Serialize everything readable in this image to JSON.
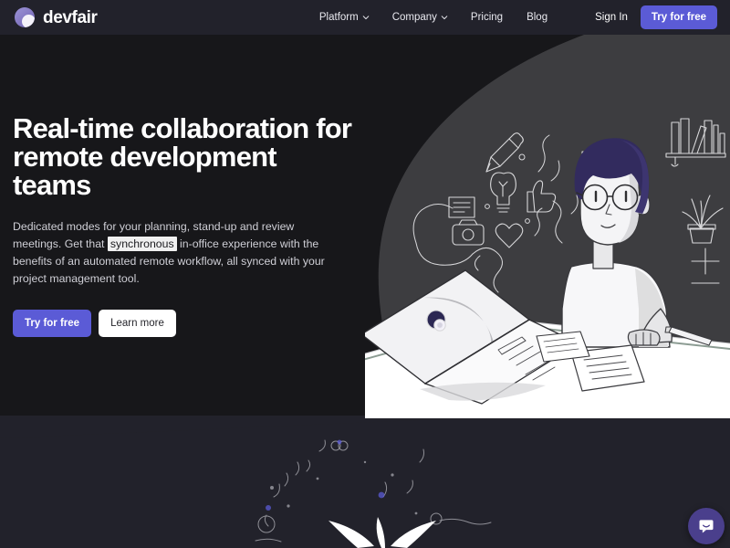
{
  "brand": {
    "name": "devfair",
    "logo_icon": "devfair-crescent-logo",
    "accent_color": "#5b5bd6",
    "logo_gradient_from": "#9b93d6",
    "logo_gradient_to": "#6f62b0"
  },
  "navbar": {
    "links": [
      {
        "label": "Platform",
        "has_dropdown": true,
        "icon": "chevron-down-icon"
      },
      {
        "label": "Company",
        "has_dropdown": true,
        "icon": "chevron-down-icon"
      },
      {
        "label": "Pricing",
        "has_dropdown": false,
        "icon": ""
      },
      {
        "label": "Blog",
        "has_dropdown": false,
        "icon": ""
      }
    ],
    "sign_in_label": "Sign In",
    "cta_label": "Try for free",
    "background_color": "#22222b"
  },
  "hero": {
    "headline": "Real-time collaboration for remote development teams",
    "subcopy_part1": "Dedicated modes for your planning, stand-up and review meetings. Get that ",
    "subcopy_highlight": "synchronous",
    "subcopy_part2": " in-office experience with the benefits of an automated remote workflow, all synced with your project management tool.",
    "primary_cta": "Try for free",
    "secondary_cta": "Learn more",
    "background_color": "#17171a",
    "blob_color": "#3d3d40",
    "lower_section_color": "#22222b"
  },
  "illustration": {
    "name": "developer-at-desk-illustration",
    "elements": [
      "pencil-doodle-icon",
      "lightbulb-doodle-icon",
      "thumbs-up-doodle-icon",
      "heart-doodle-icon",
      "document-doodle-icon",
      "camera-doodle-icon",
      "picture-frame-icon",
      "bookshelf-icon",
      "plant-icon",
      "laptop-icon",
      "person-with-glasses",
      "papers-on-desk",
      "pen-on-desk"
    ],
    "hair_color": "#322b5e",
    "skin_color": "#f2f2f4",
    "desk_color": "#ffffff",
    "line_color": "#d6d6d8"
  },
  "bottom_decor": {
    "name": "sparkle-wings-decoration",
    "color": "#ffffff"
  },
  "chat_widget": {
    "icon": "chat-bubble-icon",
    "background_color": "#4a3f8c"
  }
}
